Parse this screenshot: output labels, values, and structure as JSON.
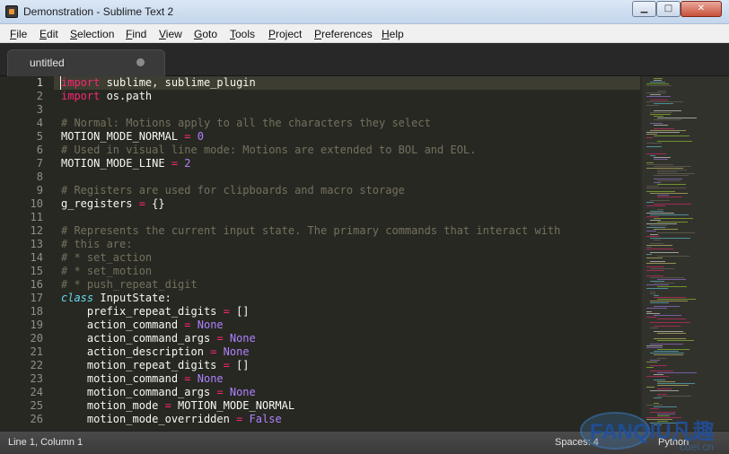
{
  "window": {
    "title": "Demonstration - Sublime Text 2",
    "app_icon": "sublime-text-icon",
    "controls": {
      "minimize": "▁",
      "maximize": "□",
      "close": "✕"
    }
  },
  "menu": {
    "items": [
      "File",
      "Edit",
      "Selection",
      "Find",
      "View",
      "Goto",
      "Tools",
      "Project",
      "Preferences",
      "Help"
    ]
  },
  "tabs": [
    {
      "label": "untitled",
      "modified_indicator": "dirty-dot-icon",
      "active": true
    }
  ],
  "editor": {
    "theme": {
      "background": "#272822",
      "foreground": "#f8f8f2",
      "keyword": "#f92672",
      "number": "#ae81ff",
      "comment": "#75715e",
      "storage": "#66d9ef"
    },
    "current_line": 1,
    "lines": [
      {
        "n": "1",
        "tokens": [
          {
            "t": "kw",
            "v": "import"
          },
          {
            "t": "txt",
            "v": " sublime, sublime_plugin"
          }
        ]
      },
      {
        "n": "2",
        "tokens": [
          {
            "t": "kw",
            "v": "import"
          },
          {
            "t": "txt",
            "v": " os.path"
          }
        ]
      },
      {
        "n": "3",
        "tokens": []
      },
      {
        "n": "4",
        "tokens": [
          {
            "t": "cmt",
            "v": "# Normal: Motions apply to all the characters they select"
          }
        ]
      },
      {
        "n": "5",
        "tokens": [
          {
            "t": "txt",
            "v": "MOTION_MODE_NORMAL "
          },
          {
            "t": "op",
            "v": "="
          },
          {
            "t": "txt",
            "v": " "
          },
          {
            "t": "num",
            "v": "0"
          }
        ]
      },
      {
        "n": "6",
        "tokens": [
          {
            "t": "cmt",
            "v": "# Used in visual line mode: Motions are extended to BOL and EOL."
          }
        ]
      },
      {
        "n": "7",
        "tokens": [
          {
            "t": "txt",
            "v": "MOTION_MODE_LINE "
          },
          {
            "t": "op",
            "v": "="
          },
          {
            "t": "txt",
            "v": " "
          },
          {
            "t": "num",
            "v": "2"
          }
        ]
      },
      {
        "n": "8",
        "tokens": []
      },
      {
        "n": "9",
        "tokens": [
          {
            "t": "cmt",
            "v": "# Registers are used for clipboards and macro storage"
          }
        ]
      },
      {
        "n": "10",
        "tokens": [
          {
            "t": "txt",
            "v": "g_registers "
          },
          {
            "t": "op",
            "v": "="
          },
          {
            "t": "txt",
            "v": " {}"
          }
        ]
      },
      {
        "n": "11",
        "tokens": []
      },
      {
        "n": "12",
        "tokens": [
          {
            "t": "cmt",
            "v": "# Represents the current input state. The primary commands that interact with"
          }
        ]
      },
      {
        "n": "13",
        "tokens": [
          {
            "t": "cmt",
            "v": "# this are:"
          }
        ]
      },
      {
        "n": "14",
        "tokens": [
          {
            "t": "cmt",
            "v": "# * set_action"
          }
        ]
      },
      {
        "n": "15",
        "tokens": [
          {
            "t": "cmt",
            "v": "# * set_motion"
          }
        ]
      },
      {
        "n": "16",
        "tokens": [
          {
            "t": "cmt",
            "v": "# * push_repeat_digit"
          }
        ]
      },
      {
        "n": "17",
        "tokens": [
          {
            "t": "stg",
            "v": "class"
          },
          {
            "t": "txt",
            "v": " InputState:"
          }
        ]
      },
      {
        "n": "18",
        "tokens": [
          {
            "t": "txt",
            "v": "    prefix_repeat_digits "
          },
          {
            "t": "op",
            "v": "="
          },
          {
            "t": "txt",
            "v": " []"
          }
        ]
      },
      {
        "n": "19",
        "tokens": [
          {
            "t": "txt",
            "v": "    action_command "
          },
          {
            "t": "op",
            "v": "="
          },
          {
            "t": "txt",
            "v": " "
          },
          {
            "t": "const",
            "v": "None"
          }
        ]
      },
      {
        "n": "20",
        "tokens": [
          {
            "t": "txt",
            "v": "    action_command_args "
          },
          {
            "t": "op",
            "v": "="
          },
          {
            "t": "txt",
            "v": " "
          },
          {
            "t": "const",
            "v": "None"
          }
        ]
      },
      {
        "n": "21",
        "tokens": [
          {
            "t": "txt",
            "v": "    action_description "
          },
          {
            "t": "op",
            "v": "="
          },
          {
            "t": "txt",
            "v": " "
          },
          {
            "t": "const",
            "v": "None"
          }
        ]
      },
      {
        "n": "22",
        "tokens": [
          {
            "t": "txt",
            "v": "    motion_repeat_digits "
          },
          {
            "t": "op",
            "v": "="
          },
          {
            "t": "txt",
            "v": " []"
          }
        ]
      },
      {
        "n": "23",
        "tokens": [
          {
            "t": "txt",
            "v": "    motion_command "
          },
          {
            "t": "op",
            "v": "="
          },
          {
            "t": "txt",
            "v": " "
          },
          {
            "t": "const",
            "v": "None"
          }
        ]
      },
      {
        "n": "24",
        "tokens": [
          {
            "t": "txt",
            "v": "    motion_command_args "
          },
          {
            "t": "op",
            "v": "="
          },
          {
            "t": "txt",
            "v": " "
          },
          {
            "t": "const",
            "v": "None"
          }
        ]
      },
      {
        "n": "25",
        "tokens": [
          {
            "t": "txt",
            "v": "    motion_mode "
          },
          {
            "t": "op",
            "v": "="
          },
          {
            "t": "txt",
            "v": " MOTION_MODE_NORMAL"
          }
        ]
      },
      {
        "n": "26",
        "tokens": [
          {
            "t": "txt",
            "v": "    motion_mode_overridden "
          },
          {
            "t": "op",
            "v": "="
          },
          {
            "t": "txt",
            "v": " "
          },
          {
            "t": "const",
            "v": "False"
          }
        ]
      }
    ]
  },
  "status": {
    "position": "Line 1, Column 1",
    "indentation": "Spaces: 4",
    "syntax": "Python"
  },
  "watermark": {
    "text": "FANQIU凡趣",
    "subtext": "cuel.cn"
  }
}
